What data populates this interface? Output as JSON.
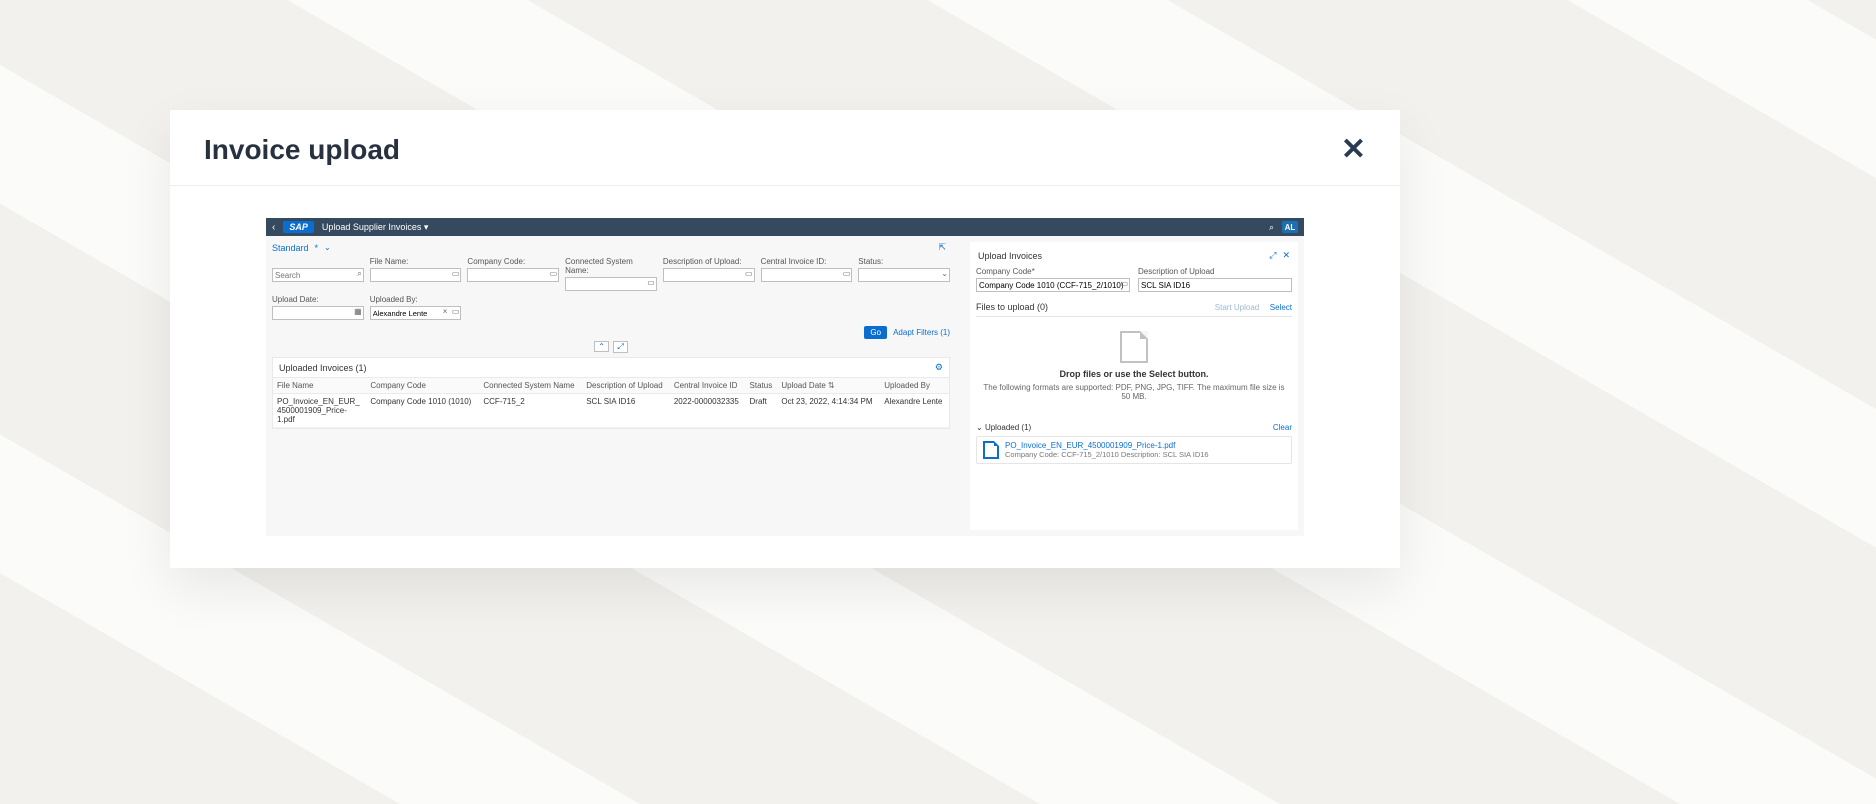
{
  "modal": {
    "title": "Invoice upload"
  },
  "sap": {
    "logo": "SAP",
    "app_title": "Upload Supplier Invoices ▾",
    "avatar": "AL"
  },
  "variant": {
    "name": "Standard",
    "star": "*"
  },
  "filters": {
    "search_label": "",
    "search_placeholder": "Search",
    "file_name": {
      "label": "File Name:"
    },
    "company_code": {
      "label": "Company Code:"
    },
    "connected_system": {
      "label": "Connected System Name:"
    },
    "description": {
      "label": "Description of Upload:"
    },
    "central_invoice": {
      "label": "Central Invoice ID:"
    },
    "status": {
      "label": "Status:"
    },
    "upload_date": {
      "label": "Upload Date:"
    },
    "uploaded_by": {
      "label": "Uploaded By:",
      "value": "Alexandre Lente"
    },
    "go": "Go",
    "adapt": "Adapt Filters (1)"
  },
  "table": {
    "title": "Uploaded Invoices (1)",
    "columns": [
      "File Name",
      "Company Code",
      "Connected System Name",
      "Description of Upload",
      "Central Invoice ID",
      "Status",
      "Upload Date",
      "Uploaded By"
    ],
    "sort_col_index": 6,
    "rows": [
      {
        "file_name": "PO_Invoice_EN_EUR_4500001909_Price-1.pdf",
        "company_code": "Company Code 1010 (1010)",
        "connected_system": "CCF-715_2",
        "description": "SCL SIA ID16",
        "central_invoice": "2022-0000032335",
        "status": "Draft",
        "upload_date": "Oct 23, 2022, 4:14:34 PM",
        "uploaded_by": "Alexandre Lente"
      }
    ]
  },
  "upload_panel": {
    "title": "Upload Invoices",
    "cc_label": "Company Code*",
    "cc_value": "Company Code 1010 (CCF-715_2/1010)",
    "desc_label": "Description of Upload",
    "desc_value": "SCL SIA ID16",
    "files_title": "Files to upload (0)",
    "start_upload": "Start Upload",
    "select": "Select",
    "drop_text": "Drop files or use the Select button.",
    "drop_sub": "The following formats are supported: PDF, PNG, JPG, TIFF. The maximum file size is 50 MB.",
    "uploaded_title": "Uploaded (1)",
    "clear": "Clear",
    "file": {
      "name": "PO_Invoice_EN_EUR_4500001909_Price-1.pdf",
      "meta": "Company Code: CCF-715_2/1010   Description: SCL SIA ID16"
    }
  }
}
